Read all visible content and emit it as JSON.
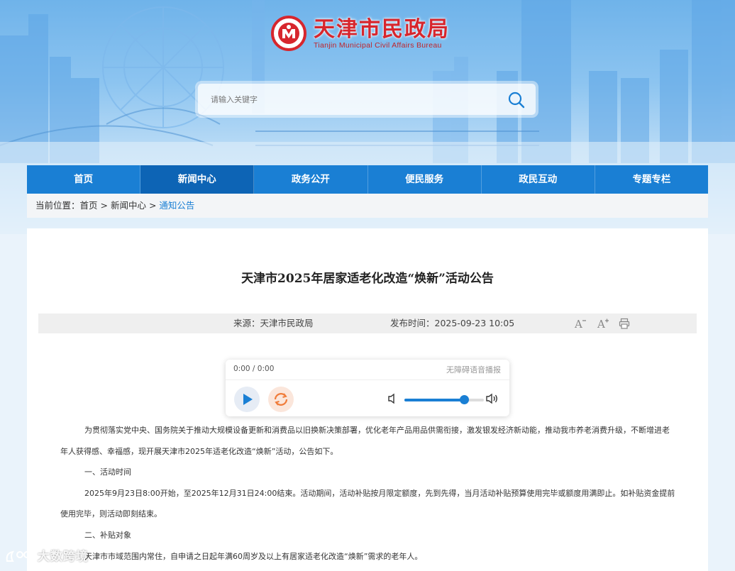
{
  "site": {
    "name": "天津市民政局",
    "name_en": "Tianjin Municipal Civil Affairs Bureau"
  },
  "search": {
    "placeholder": "请输入关键字"
  },
  "nav": {
    "items": [
      {
        "label": "首页",
        "active": false
      },
      {
        "label": "新闻中心",
        "active": true
      },
      {
        "label": "政务公开",
        "active": false
      },
      {
        "label": "便民服务",
        "active": false
      },
      {
        "label": "政民互动",
        "active": false
      },
      {
        "label": "专题专栏",
        "active": false
      }
    ]
  },
  "breadcrumb": {
    "prefix": "当前位置：",
    "items": [
      "首页",
      "新闻中心",
      "通知公告"
    ],
    "separator": " > "
  },
  "article": {
    "title": "天津市2025年居家适老化改造“焕新”活动公告",
    "source": "来源：天津市民政局",
    "publish_time": "发布时间：2025-09-23 10:05",
    "tools": {
      "font_smaller": "A-",
      "font_larger": "A+"
    },
    "paragraphs": [
      "为贯彻落实党中央、国务院关于推动大规模设备更新和消费品以旧换新决策部署，优化老年产品用品供需衔接，激发银发经济新动能，推动我市养老消费升级，不断增进老年人获得感、幸福感，现开展天津市2025年适老化改造“焕新”活动，公告如下。",
      "一、活动时间",
      "2025年9月23日8:00开始，至2025年12月31日24:00结束。活动期间，活动补贴按月限定额度，先到先得，当月活动补贴预算使用完毕或额度用满即止。如补贴资金提前使用完毕，则活动即刻结束。",
      "二、补贴对象",
      "天津市市域范围内常住，自申请之日起年满60周岁及以上有居家适老化改造“焕新”需求的老年人。"
    ]
  },
  "player": {
    "time": "0:00 / 0:00",
    "label": "无障碍语音播报",
    "volume": 0.75
  },
  "watermark": "大数跨境",
  "colors": {
    "nav_bg": "#1a7fd4",
    "nav_active": "#0d64b5",
    "brand_red": "#d7262d"
  }
}
